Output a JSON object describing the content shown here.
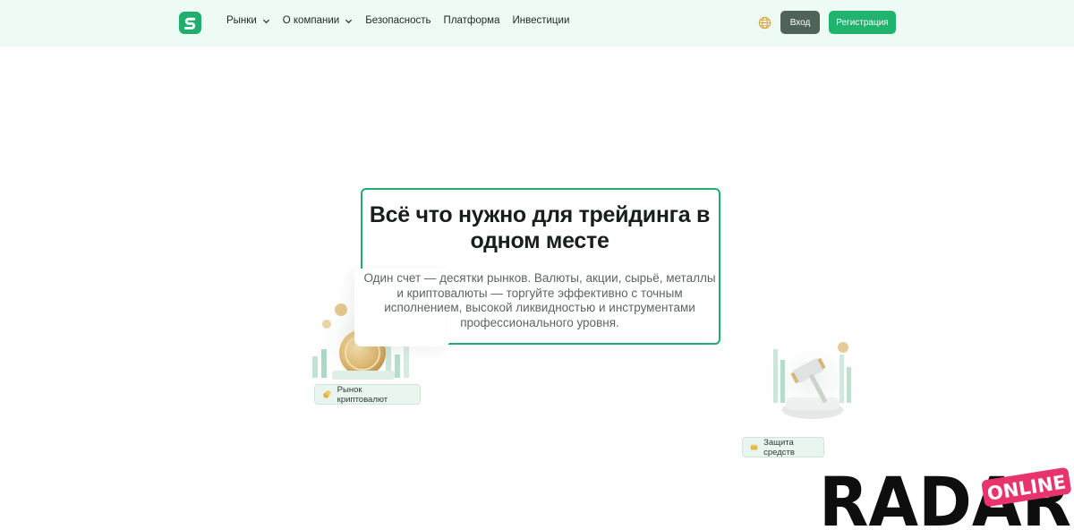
{
  "header": {
    "nav": [
      {
        "label": "Рынки",
        "dropdown": true
      },
      {
        "label": "О компании",
        "dropdown": true
      },
      {
        "label": "Безопасность",
        "dropdown": false
      },
      {
        "label": "Платформа",
        "dropdown": false
      },
      {
        "label": "Инвестиции",
        "dropdown": false
      }
    ],
    "language_icon": "globe-icon",
    "login_label": "Вход",
    "register_label": "Регистрация"
  },
  "hero": {
    "title": "Всё что нужно для трейдинга в одном месте",
    "subtitle": "Один счет — десятки рынков. Валюты, акции, сырьё, металлы и криптовалюты — торгуйте эффективно с точным исполнением, высокой ликвидностью и инструментами профессионального уровня."
  },
  "features": {
    "crypto_label": "Рынок криптовалют",
    "protect_label": "Защита средств"
  },
  "watermark": {
    "main": "RADAR",
    "badge": "ONLINE"
  },
  "colors": {
    "accent": "#1fae6d",
    "header_bg": "#eefaf4",
    "login_bg": "#4f6358",
    "watermark_badge": "#e8336d"
  }
}
